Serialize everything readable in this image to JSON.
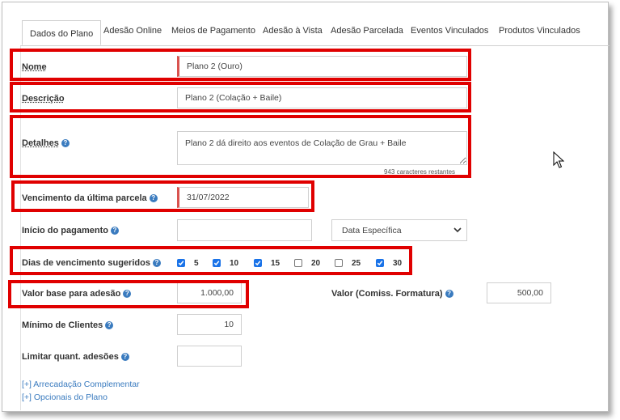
{
  "tabs": [
    {
      "label": "Dados do Plano"
    },
    {
      "label": "Adesão Online"
    },
    {
      "label": "Meios de Pagamento"
    },
    {
      "label": "Adesão à Vista"
    },
    {
      "label": "Adesão Parcelada"
    },
    {
      "label": "Eventos Vinculados"
    },
    {
      "label": "Produtos Vinculados"
    }
  ],
  "form": {
    "nome_label": "Nome",
    "nome_value": "Plano 2 (Ouro)",
    "descricao_label": "Descrição",
    "descricao_value": "Plano 2 (Colação + Baile)",
    "detalhes_label": "Detalhes",
    "detalhes_value": "Plano 2 dá direito aos eventos de Colação de Grau + Baile",
    "detalhes_counter": "943 caracteres restantes",
    "vencimento_label": "Vencimento da última parcela",
    "vencimento_value": "31/07/2022",
    "inicio_label": "Início do pagamento",
    "inicio_value": "",
    "inicio_select": "Data Específica",
    "dias_label": "Dias de vencimento sugeridos",
    "dias": [
      {
        "label": "5",
        "checked": true
      },
      {
        "label": "10",
        "checked": true
      },
      {
        "label": "15",
        "checked": true
      },
      {
        "label": "20",
        "checked": false
      },
      {
        "label": "25",
        "checked": false
      },
      {
        "label": "30",
        "checked": true
      }
    ],
    "valor_base_label": "Valor base para adesão",
    "valor_base_value": "1.000,00",
    "valor_comiss_label": "Valor (Comiss. Formatura)",
    "valor_comiss_value": "500,00",
    "minimo_label": "Mínimo de Clientes",
    "minimo_value": "10",
    "limitar_label": "Limitar quant. adesões",
    "limitar_value": ""
  },
  "links": {
    "arrecadacao": "[+] Arrecadação Complementar",
    "opcionais": "[+] Opcionais do Plano"
  },
  "icons": {
    "help": "question-circle-icon",
    "select_arrow": "chevron-down-icon",
    "cursor": "mouse-pointer-icon"
  },
  "colors": {
    "highlight": "#e00000",
    "link": "#3a7bbf",
    "checkbox": "#1a73e8",
    "required_marker": "#d9534f"
  }
}
